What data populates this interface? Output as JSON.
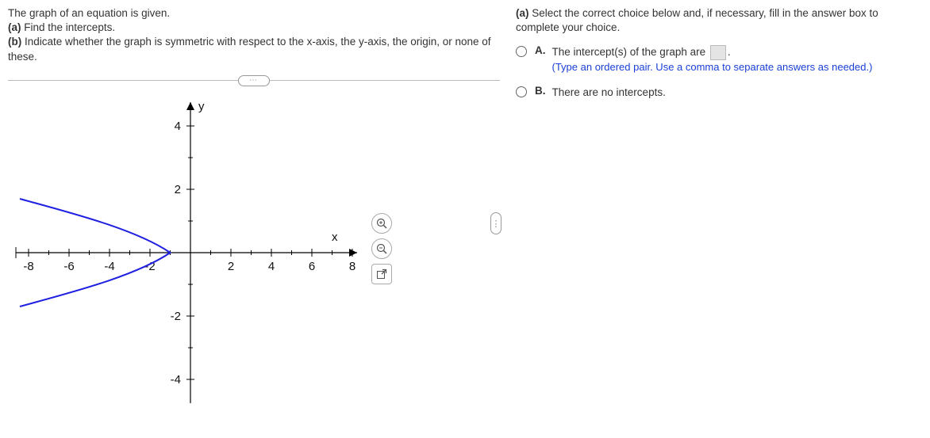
{
  "prompt": {
    "line1": "The graph of an equation is given.",
    "line2_prefix": "(a)",
    "line2": "Find the intercepts.",
    "line3_prefix": "(b)",
    "line3": "Indicate whether the graph is symmetric with respect to the x-axis, the y-axis, the origin, or none of these."
  },
  "divider_label": "⋯",
  "answer_header": {
    "prefix": "(a)",
    "text": "Select the correct choice below and, if necessary, fill in the answer box to complete your choice."
  },
  "choices": {
    "A": {
      "label": "A.",
      "text": "The intercept(s) of the graph are",
      "period": ".",
      "hint": "(Type an ordered pair. Use a comma to separate answers as needed.)"
    },
    "B": {
      "label": "B.",
      "text": "There are no intercepts."
    }
  },
  "graph": {
    "xlabel": "x",
    "ylabel": "y",
    "x_ticks": [
      "-8",
      "-6",
      "-4",
      "-2",
      "2",
      "4",
      "6",
      "8"
    ],
    "y_ticks": [
      "-4",
      "-2",
      "2",
      "4"
    ]
  },
  "chart_data": {
    "type": "parabola-horizontal",
    "vertex": [
      -1,
      0
    ],
    "opens": "left",
    "x_intercepts": [
      [
        -1,
        0
      ]
    ],
    "y_intercepts": [],
    "sample_points": [
      [
        -1,
        0
      ],
      [
        -2,
        1
      ],
      [
        -2,
        -1
      ],
      [
        -5,
        1.5
      ],
      [
        -5,
        -1.5
      ]
    ],
    "xlim": [
      -9,
      9
    ],
    "ylim": [
      -5,
      5
    ],
    "symmetry": "x-axis"
  },
  "tools": {
    "zoom_in": "⌕",
    "zoom_out": "⌖",
    "popout": "↗"
  }
}
